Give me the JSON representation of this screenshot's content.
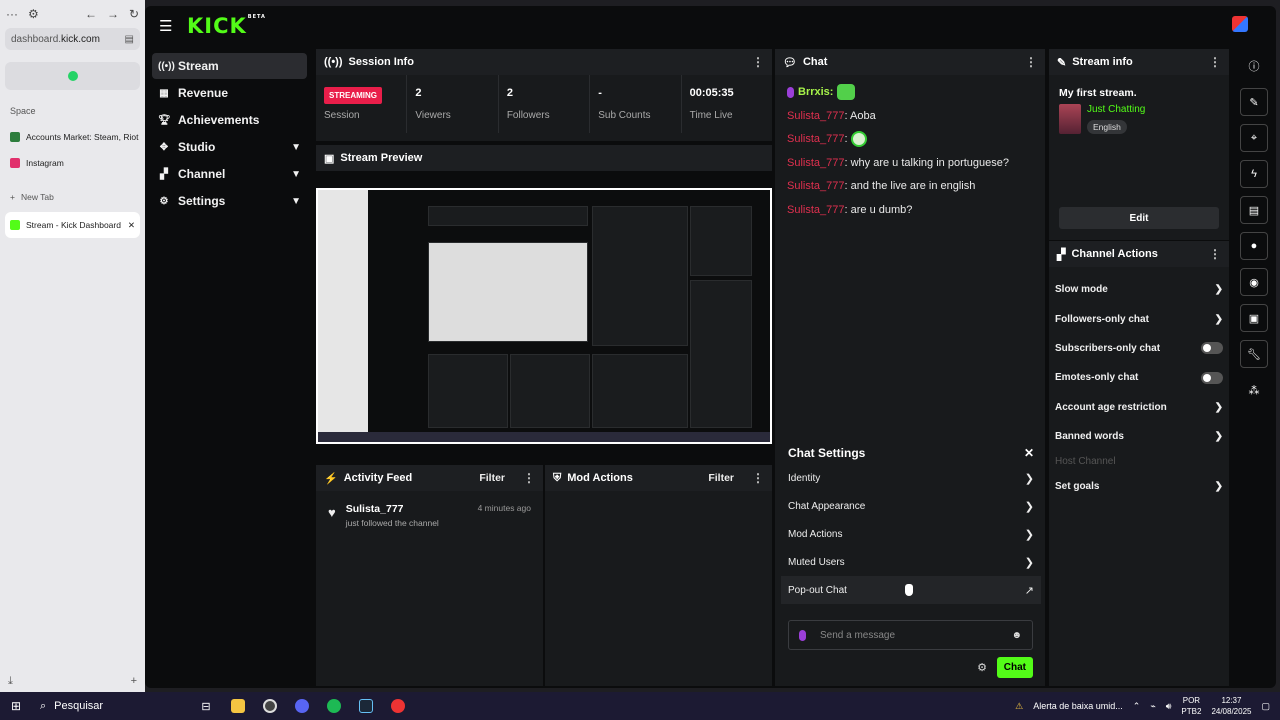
{
  "browser": {
    "url_host": "dashboard.",
    "url_domain": "kick.com",
    "space_label": "Space",
    "tabs": [
      {
        "label": "Accounts Market: Steam, Riot",
        "color": "#2d7d3d"
      },
      {
        "label": "Instagram",
        "color": "#e1306c"
      }
    ],
    "new_tab_label": "New Tab",
    "active_tab_label": "Stream - Kick Dashboard"
  },
  "kick": {
    "logo": "KICK",
    "beta": "BETA",
    "nav": [
      {
        "label": "Stream",
        "icon": "broadcast-icon"
      },
      {
        "label": "Revenue",
        "icon": "revenue-icon"
      },
      {
        "label": "Achievements",
        "icon": "trophy-icon"
      },
      {
        "label": "Studio",
        "icon": "studio-icon"
      },
      {
        "label": "Channel",
        "icon": "channel-icon"
      },
      {
        "label": "Settings",
        "icon": "gear-icon"
      }
    ],
    "session": {
      "title": "Session Info",
      "badge": "STREAMING",
      "session_label": "Session",
      "stats": [
        {
          "value": "2",
          "label": "Viewers"
        },
        {
          "value": "2",
          "label": "Followers"
        },
        {
          "value": "-",
          "label": "Sub Counts"
        },
        {
          "value": "00:05:35",
          "label": "Time Live"
        }
      ]
    },
    "preview": {
      "title": "Stream Preview"
    },
    "activity": {
      "title": "Activity Feed",
      "filter": "Filter",
      "items": [
        {
          "name": "Sulista_777",
          "text": "just followed the channel",
          "time": "4 minutes ago"
        }
      ]
    },
    "mod_actions": {
      "title": "Mod Actions",
      "filter": "Filter"
    },
    "chat": {
      "title": "Chat",
      "messages": [
        {
          "user": "Brrxis",
          "text": "",
          "emote": true,
          "owner": true
        },
        {
          "user": "Sulista_777",
          "text": ": Aoba"
        },
        {
          "user": "Sulista_777",
          "text": ": ",
          "emote2": true
        },
        {
          "user": "Sulista_777",
          "text": ": why are u talking in portuguese?"
        },
        {
          "user": "Sulista_777",
          "text": ": and the live are in english"
        },
        {
          "user": "Sulista_777",
          "text": ": are u dumb?"
        }
      ],
      "settings": {
        "title": "Chat Settings",
        "rows": [
          "Identity",
          "Chat Appearance",
          "Mod Actions",
          "Muted Users",
          "Pop-out Chat"
        ]
      },
      "placeholder": "Send a message",
      "send_label": "Chat"
    },
    "stream_info": {
      "title": "Stream info",
      "stream_title": "My first stream.",
      "category": "Just Chatting",
      "language": "English",
      "edit": "Edit"
    },
    "channel_actions": {
      "title": "Channel Actions",
      "rows": [
        {
          "label": "Slow mode",
          "type": "arrow"
        },
        {
          "label": "Followers-only chat",
          "type": "arrow"
        },
        {
          "label": "Subscribers-only chat",
          "type": "toggle"
        },
        {
          "label": "Emotes-only chat",
          "type": "toggle"
        },
        {
          "label": "Account age restriction",
          "type": "arrow"
        },
        {
          "label": "Banned words",
          "type": "arrow"
        },
        {
          "label": "Host Channel",
          "type": "disabled"
        },
        {
          "label": "Set goals",
          "type": "arrow"
        }
      ]
    }
  },
  "taskbar": {
    "search": "Pesquisar",
    "alert": "Alerta de baixa umid...",
    "lang1": "POR",
    "lang2": "PTB2",
    "time": "12:37",
    "date": "24/08/2025"
  }
}
